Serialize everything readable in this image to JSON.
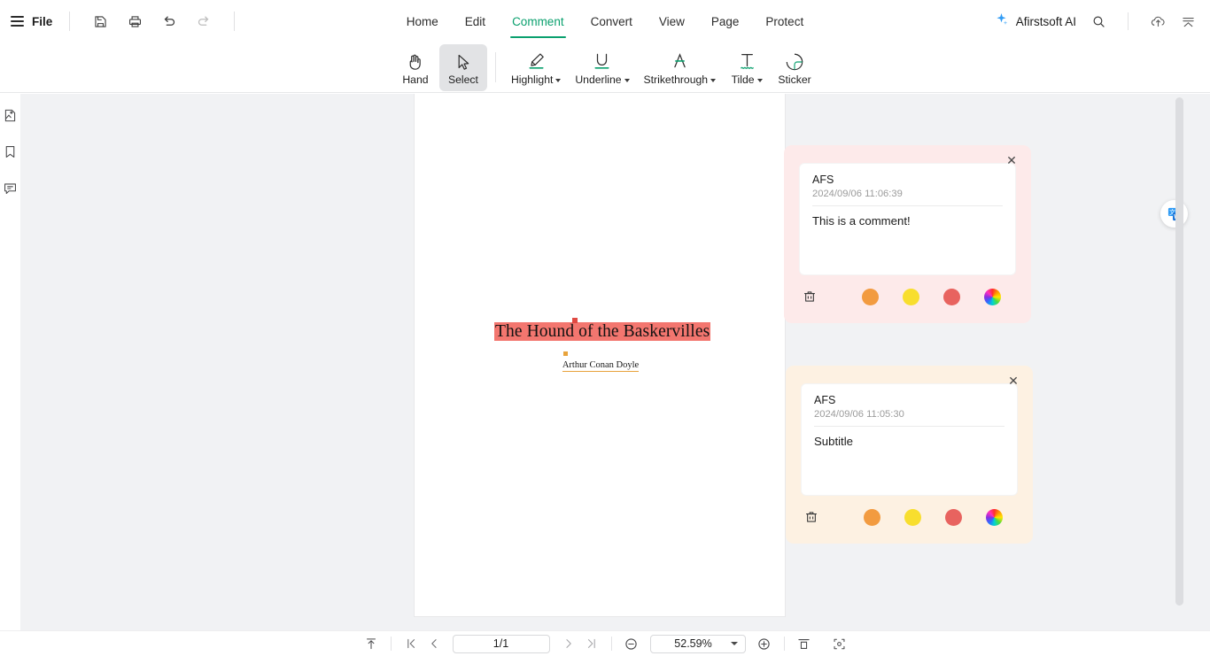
{
  "topbar": {
    "menu_icon": "hamburger-icon",
    "file_label": "File",
    "quick_actions": [
      {
        "name": "save-icon",
        "title": "Save"
      },
      {
        "name": "print-icon",
        "title": "Print"
      },
      {
        "name": "undo-icon",
        "title": "Undo"
      },
      {
        "name": "redo-icon",
        "title": "Redo"
      }
    ],
    "tabs": [
      {
        "label": "Home",
        "active": false
      },
      {
        "label": "Edit",
        "active": false
      },
      {
        "label": "Comment",
        "active": true
      },
      {
        "label": "Convert",
        "active": false
      },
      {
        "label": "View",
        "active": false
      },
      {
        "label": "Page",
        "active": false
      },
      {
        "label": "Protect",
        "active": false
      }
    ],
    "ai_label": "Afirstsoft AI",
    "search_icon": "search-icon",
    "cloud_icon": "cloud-upload-icon",
    "collapse_icon": "collapse-ribbon-icon",
    "active_tab_color": "#0aa06e"
  },
  "ribbon": {
    "tools": [
      {
        "label": "Hand",
        "icon": "hand-icon",
        "caret": false,
        "selected": false
      },
      {
        "label": "Select",
        "icon": "cursor-arrow-icon",
        "caret": false,
        "selected": true
      },
      {
        "label": "Highlight",
        "icon": "highlighter-icon",
        "caret": true,
        "selected": false
      },
      {
        "label": "Underline",
        "icon": "underline-icon",
        "caret": true,
        "selected": false
      },
      {
        "label": "Strikethrough",
        "icon": "strikethrough-icon",
        "caret": true,
        "selected": false
      },
      {
        "label": "Tilde",
        "icon": "tilde-icon",
        "caret": true,
        "selected": false
      },
      {
        "label": "Sticker",
        "icon": "sticker-icon",
        "caret": false,
        "selected": false
      }
    ]
  },
  "left_rail": {
    "items": [
      {
        "name": "thumbnails-icon",
        "title": "Thumbnails"
      },
      {
        "name": "bookmark-icon",
        "title": "Bookmarks"
      },
      {
        "name": "comments-panel-icon",
        "title": "Comments"
      }
    ]
  },
  "document": {
    "title": "The Hound of the Baskervilles",
    "author": "Arthur Conan Doyle",
    "title_highlight_color": "#f3766f",
    "author_underline_color": "#e8a33c",
    "title_anchor_color": "#e04a43",
    "author_anchor_color": "#e8a33c"
  },
  "comments": [
    {
      "author": "AFS",
      "timestamp": "2024/09/06 11:06:39",
      "text": "This is a comment!",
      "bg": "#fdeaea",
      "close_icon": "close-icon",
      "delete_icon": "trash-icon",
      "swatches": [
        "#f29b40",
        "#f8de2e",
        "#e8635f"
      ],
      "wheel_icon": "color-wheel-icon"
    },
    {
      "author": "AFS",
      "timestamp": "2024/09/06 11:05:30",
      "text": "Subtitle",
      "bg": "#fdf1e2",
      "close_icon": "close-icon",
      "delete_icon": "trash-icon",
      "swatches": [
        "#f29b40",
        "#f8de2e",
        "#e8635f"
      ],
      "wheel_icon": "color-wheel-icon"
    }
  ],
  "floating": {
    "translate_icon": "translate-icon",
    "properties_icon": "properties-panel-icon"
  },
  "statusbar": {
    "scroll_top_icon": "scroll-to-top-icon",
    "first_page_icon": "first-page-icon",
    "prev_page_icon": "previous-page-icon",
    "page_value": "1/1",
    "next_page_icon": "next-page-icon",
    "last_page_icon": "last-page-icon",
    "zoom_out_icon": "zoom-out-icon",
    "zoom_value": "52.59%",
    "zoom_in_icon": "zoom-in-icon",
    "fit_page_icon": "fit-page-icon",
    "fit_width_icon": "fit-width-icon"
  }
}
